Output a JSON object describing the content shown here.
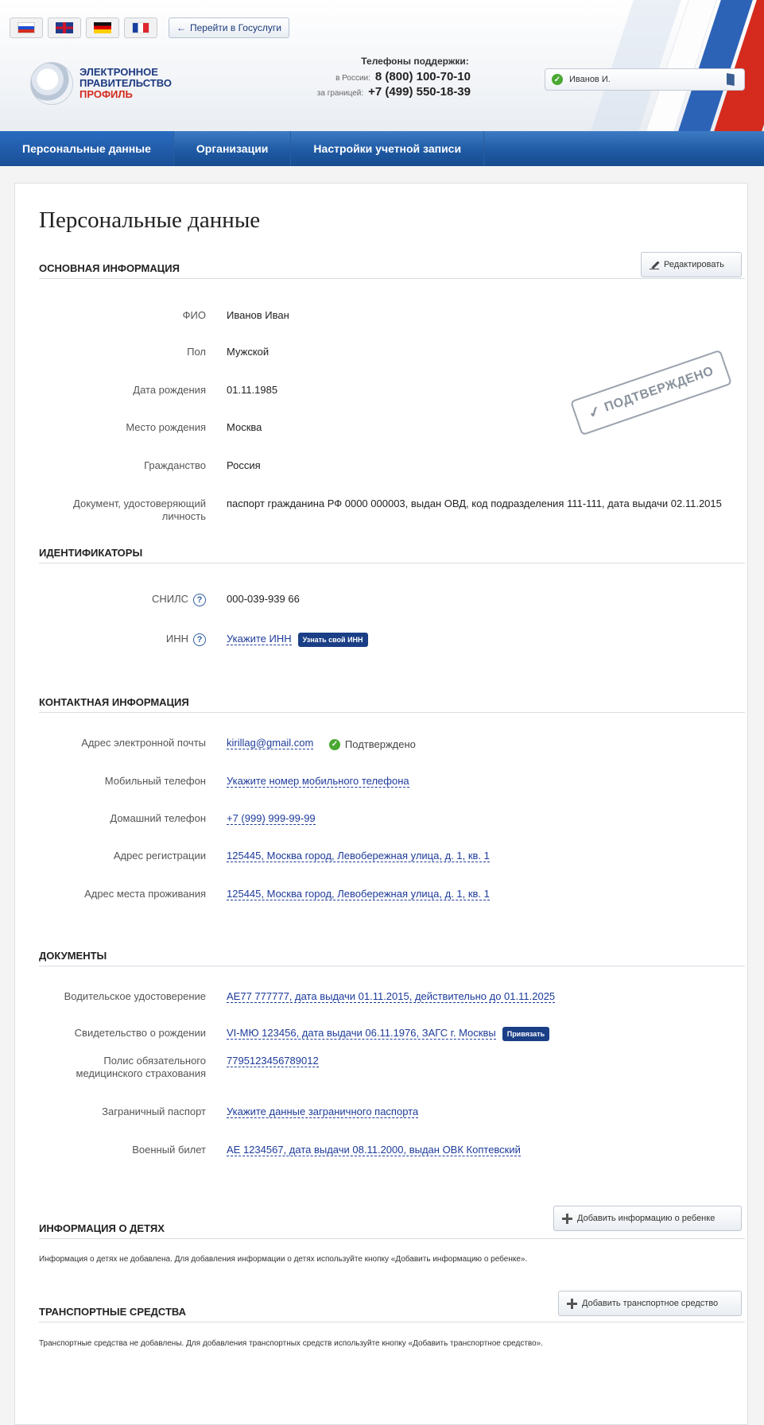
{
  "header": {
    "goto_label": "Перейти в Госуслуги",
    "goto_arrow": "←",
    "logo": {
      "line1": "ЭЛЕКТРОННОЕ",
      "line2": "ПРАВИТЕЛЬСТВО",
      "line3": "ПРОФИЛЬ"
    },
    "phones": {
      "caption": "Телефоны поддержки:",
      "russia_label": "в России:",
      "russia_number": "8 (800) 100-70-10",
      "abroad_label": "за границей:",
      "abroad_number": "+7 (499) 550-18-39"
    },
    "user": {
      "name": "Иванов И.",
      "status_icon": "check-circle-icon",
      "exit_icon": "exit-icon"
    }
  },
  "nav": {
    "items": [
      {
        "label": "Персональные данные",
        "active": true
      },
      {
        "label": "Организации",
        "active": false
      },
      {
        "label": "Настройки учетной записи",
        "active": false
      }
    ]
  },
  "page": {
    "title": "Персональные данные",
    "stamp": "ПОДТВЕРЖДЕНО",
    "basic": {
      "title": "ОСНОВНАЯ ИНФОРМАЦИЯ",
      "edit_label": "Редактировать",
      "rows": [
        {
          "label": "ФИО",
          "value": "Иванов Иван"
        },
        {
          "label": "Пол",
          "value": "Мужской"
        },
        {
          "label": "Дата рождения",
          "value": "01.11.1985"
        },
        {
          "label": "Место рождения",
          "value": "Москва"
        },
        {
          "label": "Гражданство",
          "value": "Россия"
        },
        {
          "label_line1": "Документ, удостоверяющий",
          "label_line2": "личность",
          "value": "паспорт гражданина РФ 0000 000003, выдан ОВД, код подразделения 111-111, дата выдачи 02.11.2015"
        }
      ]
    },
    "ids": {
      "title": "ИДЕНТИФИКАТОРЫ",
      "snils_label": "СНИЛС",
      "snils_value": "000-039-939 66",
      "inn_label": "ИНН",
      "inn_value": "Укажите ИНН",
      "inn_button": "Узнать свой ИНН",
      "help_glyph": "?"
    },
    "contacts": {
      "title": "КОНТАКТНАЯ ИНФОРМАЦИЯ",
      "email_label": "Адрес электронной почты",
      "email_value": "kirillag@gmail.com",
      "email_status": "Подтверждено",
      "mobile_label": "Мобильный телефон",
      "mobile_value": "Укажите номер мобильного телефона",
      "home_label": "Домашний телефон",
      "home_value": "+7 (999) 999-99-99",
      "reg_label": "Адрес регистрации",
      "reg_value": "125445, Москва город, Левобережная улица, д. 1, кв. 1",
      "live_label": "Адрес места проживания",
      "live_value": "125445, Москва город, Левобережная улица, д. 1, кв. 1"
    },
    "docs": {
      "title": "ДОКУМЕНТЫ",
      "driver_label": "Водительское удостоверение",
      "driver_value": "АЕ77 777777, дата выдачи 01.11.2015, действительно до 01.11.2025",
      "birth_label": "Свидетельство о рождении",
      "birth_value": "VI-МЮ 123456, дата выдачи 06.11.1976, ЗАГС г. Москвы",
      "birth_button": "Привязать",
      "oms_label_line1": "Полис обязательного",
      "oms_label_line2": "медицинского страхования",
      "oms_value": "7795123456789012",
      "foreign_label": "Заграничный паспорт",
      "foreign_value": "Укажите данные заграничного паспорта",
      "military_label": "Военный билет",
      "military_value": "АЕ 1234567, дата выдачи 08.11.2000, выдан ОВК Коптевский"
    },
    "children": {
      "title": "ИНФОРМАЦИЯ О ДЕТЯХ",
      "add_label": "Добавить информацию о ребенке",
      "note": "Информация о детях не добавлена. Для добавления информации о детях используйте кнопку «Добавить информацию о ребенке»."
    },
    "vehicles": {
      "title": "ТРАНСПОРТНЫЕ СРЕДСТВА",
      "add_label": "Добавить транспортное средство",
      "note": "Транспортные средства не добавлены. Для добавления транспортных средств используйте кнопку «Добавить транспортное средство»."
    }
  }
}
